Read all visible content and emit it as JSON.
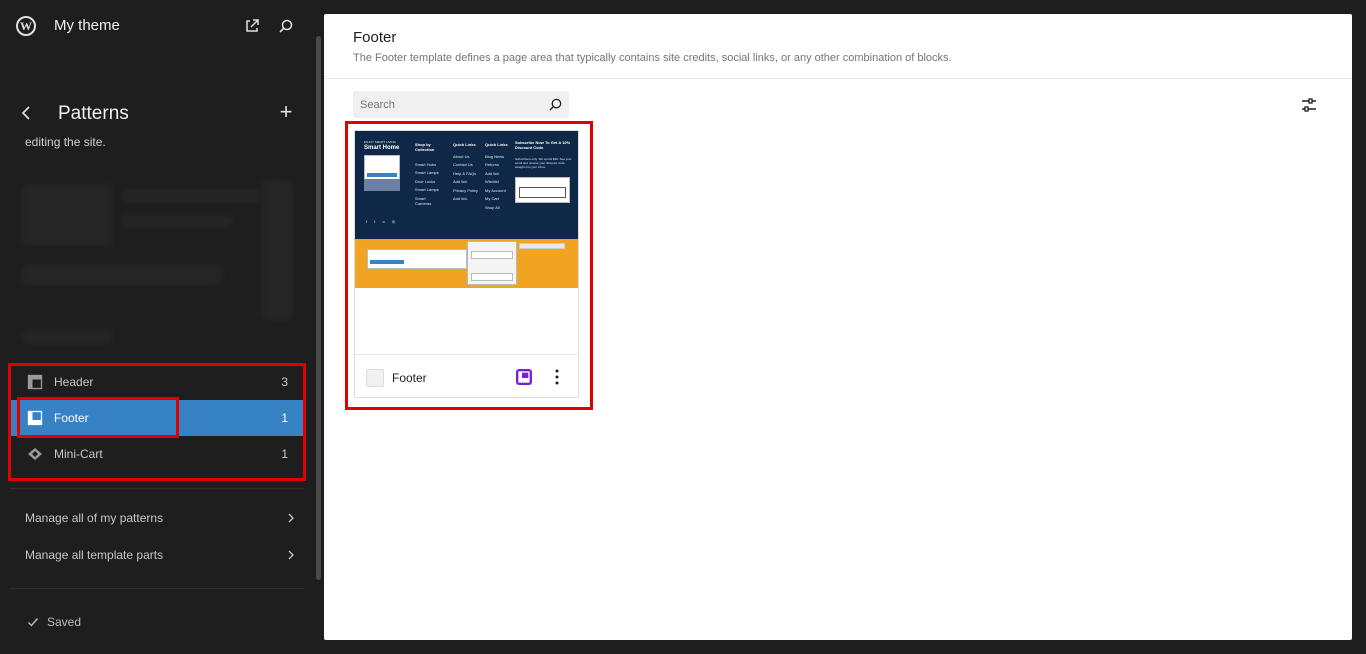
{
  "site": {
    "title": "My theme",
    "icons": {
      "logo": "wordpress-logo",
      "external": "external-link-icon",
      "search": "search-icon"
    }
  },
  "sidebar": {
    "section_title": "Patterns",
    "description": "editing the site.",
    "items": [
      {
        "label": "Header",
        "count": "3",
        "icon": "header-icon",
        "active": false
      },
      {
        "label": "Footer",
        "count": "1",
        "icon": "footer-icon",
        "active": true
      },
      {
        "label": "Mini-Cart",
        "count": "1",
        "icon": "mini-cart-icon",
        "active": false
      }
    ],
    "links": [
      {
        "label": "Manage all of my patterns"
      },
      {
        "label": "Manage all template parts"
      }
    ],
    "status": "Saved"
  },
  "main": {
    "title": "Footer",
    "description": "The Footer template defines a page area that typically contains site credits, social links, or any other combination of blocks.",
    "search": {
      "placeholder": "Search"
    },
    "cards": [
      {
        "title": "Footer",
        "preview": {
          "brand_small": "ENJOY SMART LIVING",
          "brand": "Smart Home",
          "col1_title": "Shop by Collection",
          "col1_items": [
            "Smart Hubs",
            "Smart Lamps",
            "Door Locks",
            "Smart Lamps",
            "Smart Cameras"
          ],
          "col2_title": "Quick Links",
          "col2_items": [
            "About Us",
            "Contact Us",
            "Help & FAQs",
            "Add link",
            "Privacy Policy",
            "Add link"
          ],
          "col3_title": "Quick Links",
          "col3_items": [
            "Blog News",
            "Returns",
            "Add link",
            "Wishlist",
            "My Account",
            "My Cart",
            "Shop All"
          ],
          "subscribe_title": "Subscribe Now To Get A 10% Discount Code.",
          "subscribe_text": "Subscribers only. We spend $30. See your email and receive your discount code straight into your inbox."
        }
      }
    ]
  },
  "colors": {
    "sidebar_bg": "#1e1e1e",
    "active_item": "#3682c5",
    "highlight": "#e00000",
    "preview_dark": "#0f2847",
    "preview_orange": "#f0a422",
    "badge": "#7b1fd6"
  }
}
